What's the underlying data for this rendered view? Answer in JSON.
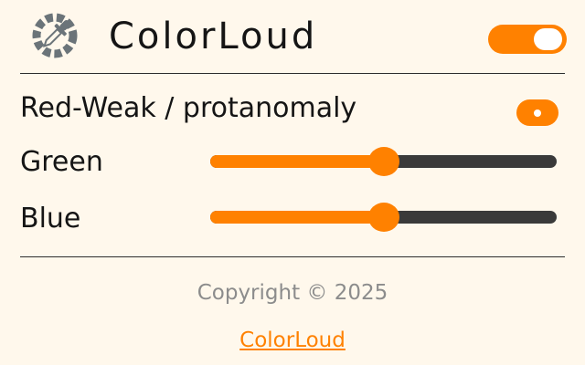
{
  "header": {
    "title": "ColorLoud",
    "logo_icon": "color-dropper-logo-icon",
    "toggle_on": true
  },
  "filter": {
    "mode_label": "Red-Weak / protanomaly",
    "mode_selected": true
  },
  "sliders": [
    {
      "label": "Green",
      "value_fraction": 0.5
    },
    {
      "label": "Blue",
      "value_fraction": 0.5
    }
  ],
  "footer": {
    "copyright": "Copyright © 2025",
    "link_text": "ColorLoud"
  },
  "colors": {
    "accent": "#ff8100",
    "track": "#3a3a3a",
    "background": "#fff8ec",
    "logo_gray": "#6b7479",
    "muted_text": "#8c8c8c"
  }
}
